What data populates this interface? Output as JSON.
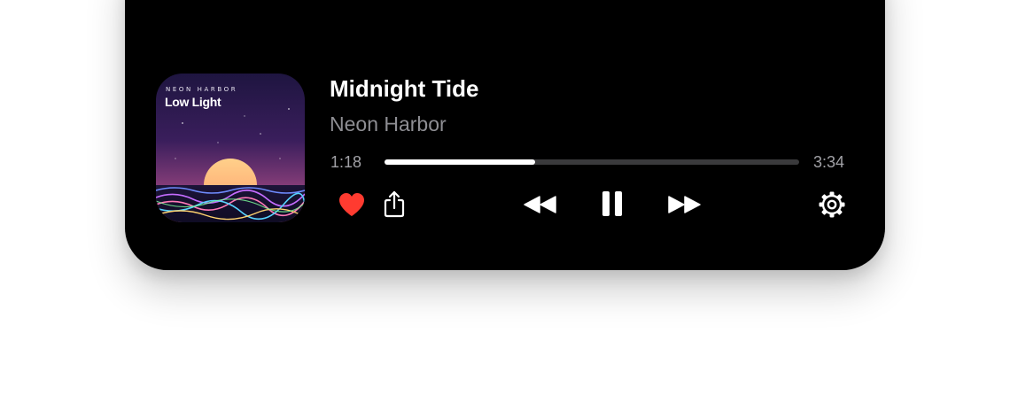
{
  "track": {
    "title": "Midnight Tide",
    "artist": "Neon Harbor"
  },
  "album_art": {
    "artist_text": "NEON HARBOR",
    "album_text": "Low Light"
  },
  "progress": {
    "elapsed": "1:18",
    "total": "3:34",
    "fraction": 0.364
  },
  "controls": {
    "favorite_icon": "heart-icon",
    "share_icon": "share-icon",
    "previous_icon": "rewind-icon",
    "play_pause_icon": "pause-icon",
    "next_icon": "fast-forward-icon",
    "settings_icon": "gear-icon"
  },
  "colors": {
    "background": "#000000",
    "favorite": "#ff3b30",
    "secondary_text": "#8e8e93",
    "track_fill": "#ffffff",
    "track_bg": "#3a3a3c"
  }
}
